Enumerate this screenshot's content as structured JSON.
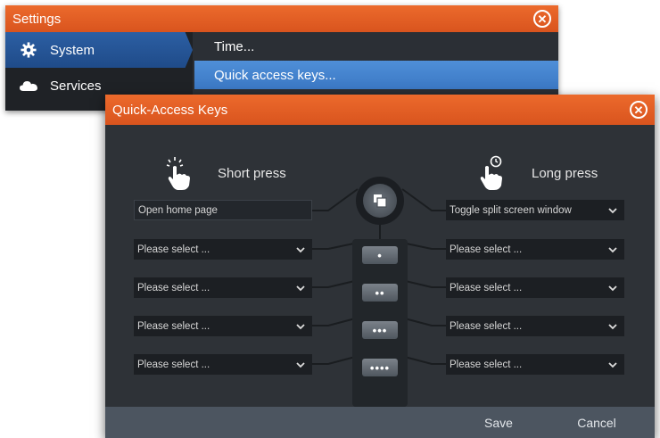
{
  "settings": {
    "title": "Settings",
    "sidebar": [
      {
        "label": "System",
        "icon": "gear-icon",
        "selected": true
      },
      {
        "label": "Services",
        "icon": "cloud-icon",
        "selected": false
      }
    ],
    "list": [
      {
        "label": "Time...",
        "selected": false
      },
      {
        "label": "Quick access keys...",
        "selected": true
      }
    ]
  },
  "dialog": {
    "title": "Quick-Access Keys",
    "short_press": {
      "label": "Short press",
      "icon": "tap-hand-icon",
      "slots": [
        "Open home page",
        "Please select ...",
        "Please select ...",
        "Please select ...",
        "Please select ..."
      ]
    },
    "long_press": {
      "label": "Long press",
      "icon": "long-press-hand-icon",
      "slots": [
        "Toggle split screen window",
        "Please select ...",
        "Please select ...",
        "Please select ...",
        "Please select ..."
      ]
    },
    "keys": [
      "•",
      "••",
      "•••",
      "••••"
    ],
    "center_icon": "pages-icon",
    "save_label": "Save",
    "cancel_label": "Cancel"
  },
  "colors": {
    "titlebar": "#e0602a",
    "selected_side": "#2c5fa3",
    "selected_list": "#4683ce",
    "dialog_bg": "#2e3237",
    "footer_bg": "#4c5560"
  }
}
